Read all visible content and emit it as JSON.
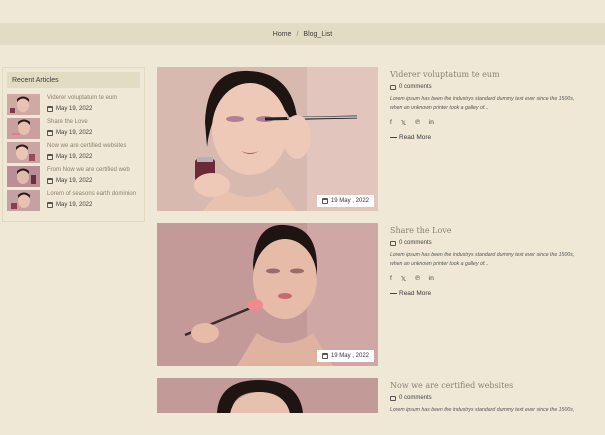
{
  "breadcrumb": {
    "home": "Home",
    "separator": "/",
    "current": "Blog_List"
  },
  "sidebar": {
    "title": "Recent Articles",
    "articles": [
      {
        "title": "Viderer voluptatum te eum",
        "date": "May 19, 2022"
      },
      {
        "title": "Share the Love",
        "date": "May 19, 2022"
      },
      {
        "title": "Now we are certified websites",
        "date": "May 19, 2022"
      },
      {
        "title": "From Now we are certified web",
        "date": "May 19, 2022"
      },
      {
        "title": "Lorem of seasons earth dominion",
        "date": "May 19, 2022"
      }
    ]
  },
  "posts": [
    {
      "title": "Viderer voluptatum te eum",
      "comments": "0 comments",
      "excerpt_line1": "Lorem ipsum has been the industrys standard dummy text ever since the 1500s,",
      "excerpt_line2": "when an unknown printer took a galley of...",
      "read_more": "Read More",
      "date_badge": "19 May , 2022"
    },
    {
      "title": "Share the Love",
      "comments": "0 comments",
      "excerpt_line1": "Lorem ipsum has been the industrys standard dummy text ever since the 1500s,",
      "excerpt_line2": "when an unknown printer took a galley of...",
      "read_more": "Read More",
      "date_badge": "19 May , 2022"
    },
    {
      "title": "Now we are certified websites",
      "comments": "0 comments",
      "excerpt_line1": "Lorem ipsum has been the industrys standard dummy text ever since the 1500s,",
      "excerpt_line2": "",
      "read_more": "",
      "date_badge": ""
    }
  ],
  "social_icons": [
    "facebook-icon",
    "twitter-icon",
    "pinterest-icon",
    "linkedin-icon"
  ],
  "colors": {
    "page_bg": "#efe8d6",
    "bar_bg": "#e3dcc5",
    "accent_text": "#8b8270"
  }
}
